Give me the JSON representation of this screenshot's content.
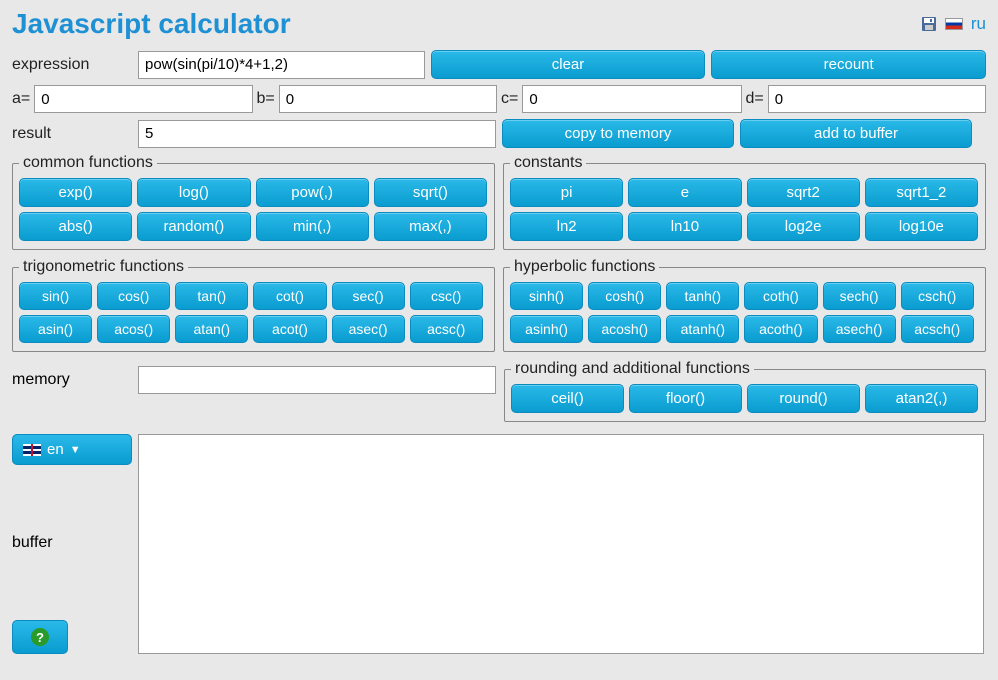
{
  "title": "Javascript calculator",
  "header": {
    "lang_link": "ru"
  },
  "labels": {
    "expression": "expression",
    "a": "a=",
    "b": "b=",
    "c": "c=",
    "d": "d=",
    "result": "result",
    "memory": "memory",
    "buffer": "buffer"
  },
  "inputs": {
    "expression": "pow(sin(pi/10)*4+1,2)",
    "a": "0",
    "b": "0",
    "c": "0",
    "d": "0",
    "result": "5",
    "memory": "",
    "buffer": ""
  },
  "buttons": {
    "clear": "clear",
    "recount": "recount",
    "copy_memory": "copy to memory",
    "add_buffer": "add to buffer"
  },
  "groups": {
    "common": {
      "legend": "common functions",
      "items": [
        "exp()",
        "log()",
        "pow(,)",
        "sqrt()",
        "abs()",
        "random()",
        "min(,)",
        "max(,)"
      ]
    },
    "constants": {
      "legend": "constants",
      "items": [
        "pi",
        "e",
        "sqrt2",
        "sqrt1_2",
        "ln2",
        "ln10",
        "log2e",
        "log10e"
      ]
    },
    "trig": {
      "legend": "trigonometric functions",
      "items": [
        "sin()",
        "cos()",
        "tan()",
        "cot()",
        "sec()",
        "csc()",
        "asin()",
        "acos()",
        "atan()",
        "acot()",
        "asec()",
        "acsc()"
      ]
    },
    "hyper": {
      "legend": "hyperbolic functions",
      "items": [
        "sinh()",
        "cosh()",
        "tanh()",
        "coth()",
        "sech()",
        "csch()",
        "asinh()",
        "acosh()",
        "atanh()",
        "acoth()",
        "asech()",
        "acsch()"
      ]
    },
    "rounding": {
      "legend": "rounding and additional functions",
      "items": [
        "ceil()",
        "floor()",
        "round()",
        "atan2(,)"
      ]
    }
  },
  "lang_select": "en"
}
